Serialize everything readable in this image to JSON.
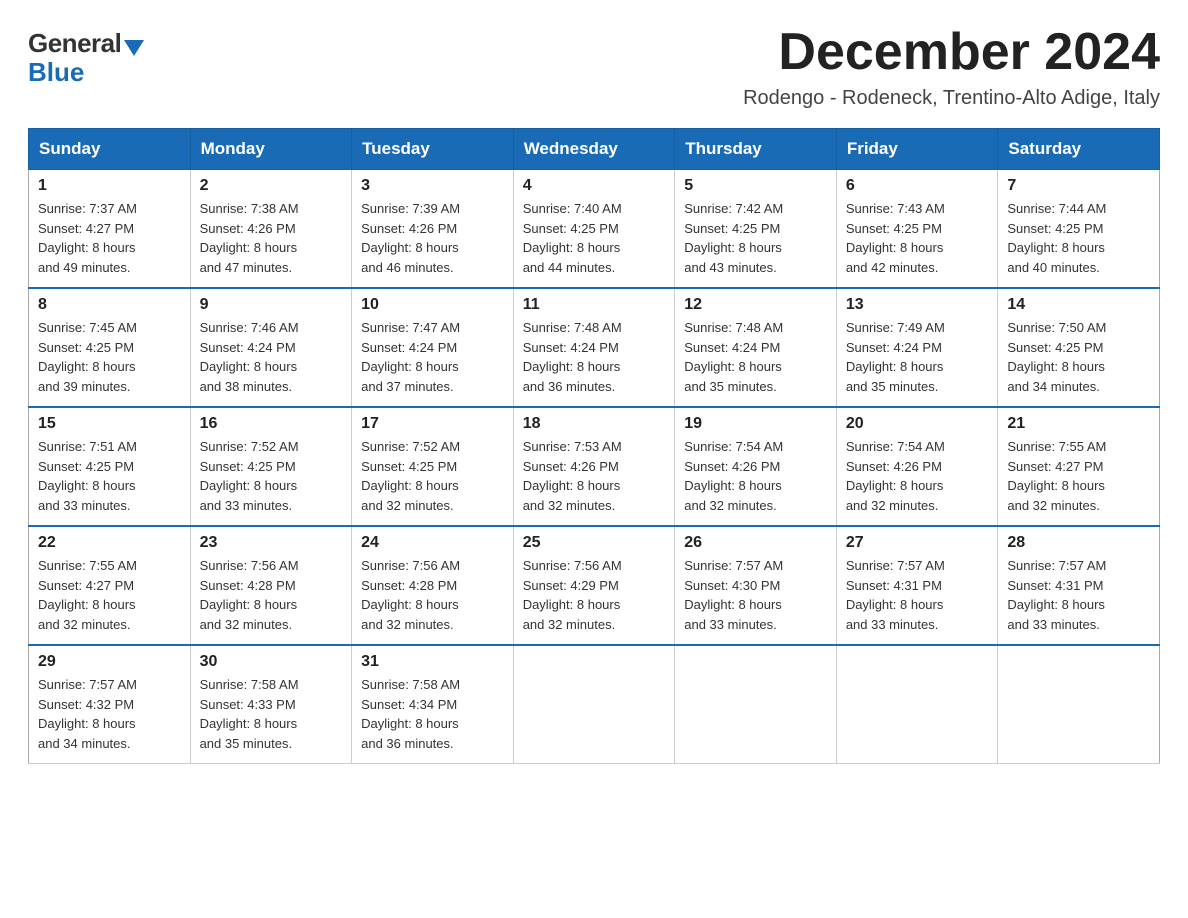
{
  "logo": {
    "general": "General",
    "blue": "Blue"
  },
  "title": "December 2024",
  "location": "Rodengo - Rodeneck, Trentino-Alto Adige, Italy",
  "days_of_week": [
    "Sunday",
    "Monday",
    "Tuesday",
    "Wednesday",
    "Thursday",
    "Friday",
    "Saturday"
  ],
  "weeks": [
    [
      {
        "day": "1",
        "sunrise": "7:37 AM",
        "sunset": "4:27 PM",
        "daylight": "8 hours and 49 minutes."
      },
      {
        "day": "2",
        "sunrise": "7:38 AM",
        "sunset": "4:26 PM",
        "daylight": "8 hours and 47 minutes."
      },
      {
        "day": "3",
        "sunrise": "7:39 AM",
        "sunset": "4:26 PM",
        "daylight": "8 hours and 46 minutes."
      },
      {
        "day": "4",
        "sunrise": "7:40 AM",
        "sunset": "4:25 PM",
        "daylight": "8 hours and 44 minutes."
      },
      {
        "day": "5",
        "sunrise": "7:42 AM",
        "sunset": "4:25 PM",
        "daylight": "8 hours and 43 minutes."
      },
      {
        "day": "6",
        "sunrise": "7:43 AM",
        "sunset": "4:25 PM",
        "daylight": "8 hours and 42 minutes."
      },
      {
        "day": "7",
        "sunrise": "7:44 AM",
        "sunset": "4:25 PM",
        "daylight": "8 hours and 40 minutes."
      }
    ],
    [
      {
        "day": "8",
        "sunrise": "7:45 AM",
        "sunset": "4:25 PM",
        "daylight": "8 hours and 39 minutes."
      },
      {
        "day": "9",
        "sunrise": "7:46 AM",
        "sunset": "4:24 PM",
        "daylight": "8 hours and 38 minutes."
      },
      {
        "day": "10",
        "sunrise": "7:47 AM",
        "sunset": "4:24 PM",
        "daylight": "8 hours and 37 minutes."
      },
      {
        "day": "11",
        "sunrise": "7:48 AM",
        "sunset": "4:24 PM",
        "daylight": "8 hours and 36 minutes."
      },
      {
        "day": "12",
        "sunrise": "7:48 AM",
        "sunset": "4:24 PM",
        "daylight": "8 hours and 35 minutes."
      },
      {
        "day": "13",
        "sunrise": "7:49 AM",
        "sunset": "4:24 PM",
        "daylight": "8 hours and 35 minutes."
      },
      {
        "day": "14",
        "sunrise": "7:50 AM",
        "sunset": "4:25 PM",
        "daylight": "8 hours and 34 minutes."
      }
    ],
    [
      {
        "day": "15",
        "sunrise": "7:51 AM",
        "sunset": "4:25 PM",
        "daylight": "8 hours and 33 minutes."
      },
      {
        "day": "16",
        "sunrise": "7:52 AM",
        "sunset": "4:25 PM",
        "daylight": "8 hours and 33 minutes."
      },
      {
        "day": "17",
        "sunrise": "7:52 AM",
        "sunset": "4:25 PM",
        "daylight": "8 hours and 32 minutes."
      },
      {
        "day": "18",
        "sunrise": "7:53 AM",
        "sunset": "4:26 PM",
        "daylight": "8 hours and 32 minutes."
      },
      {
        "day": "19",
        "sunrise": "7:54 AM",
        "sunset": "4:26 PM",
        "daylight": "8 hours and 32 minutes."
      },
      {
        "day": "20",
        "sunrise": "7:54 AM",
        "sunset": "4:26 PM",
        "daylight": "8 hours and 32 minutes."
      },
      {
        "day": "21",
        "sunrise": "7:55 AM",
        "sunset": "4:27 PM",
        "daylight": "8 hours and 32 minutes."
      }
    ],
    [
      {
        "day": "22",
        "sunrise": "7:55 AM",
        "sunset": "4:27 PM",
        "daylight": "8 hours and 32 minutes."
      },
      {
        "day": "23",
        "sunrise": "7:56 AM",
        "sunset": "4:28 PM",
        "daylight": "8 hours and 32 minutes."
      },
      {
        "day": "24",
        "sunrise": "7:56 AM",
        "sunset": "4:28 PM",
        "daylight": "8 hours and 32 minutes."
      },
      {
        "day": "25",
        "sunrise": "7:56 AM",
        "sunset": "4:29 PM",
        "daylight": "8 hours and 32 minutes."
      },
      {
        "day": "26",
        "sunrise": "7:57 AM",
        "sunset": "4:30 PM",
        "daylight": "8 hours and 33 minutes."
      },
      {
        "day": "27",
        "sunrise": "7:57 AM",
        "sunset": "4:31 PM",
        "daylight": "8 hours and 33 minutes."
      },
      {
        "day": "28",
        "sunrise": "7:57 AM",
        "sunset": "4:31 PM",
        "daylight": "8 hours and 33 minutes."
      }
    ],
    [
      {
        "day": "29",
        "sunrise": "7:57 AM",
        "sunset": "4:32 PM",
        "daylight": "8 hours and 34 minutes."
      },
      {
        "day": "30",
        "sunrise": "7:58 AM",
        "sunset": "4:33 PM",
        "daylight": "8 hours and 35 minutes."
      },
      {
        "day": "31",
        "sunrise": "7:58 AM",
        "sunset": "4:34 PM",
        "daylight": "8 hours and 36 minutes."
      },
      null,
      null,
      null,
      null
    ]
  ],
  "labels": {
    "sunrise": "Sunrise:",
    "sunset": "Sunset:",
    "daylight": "Daylight:"
  }
}
